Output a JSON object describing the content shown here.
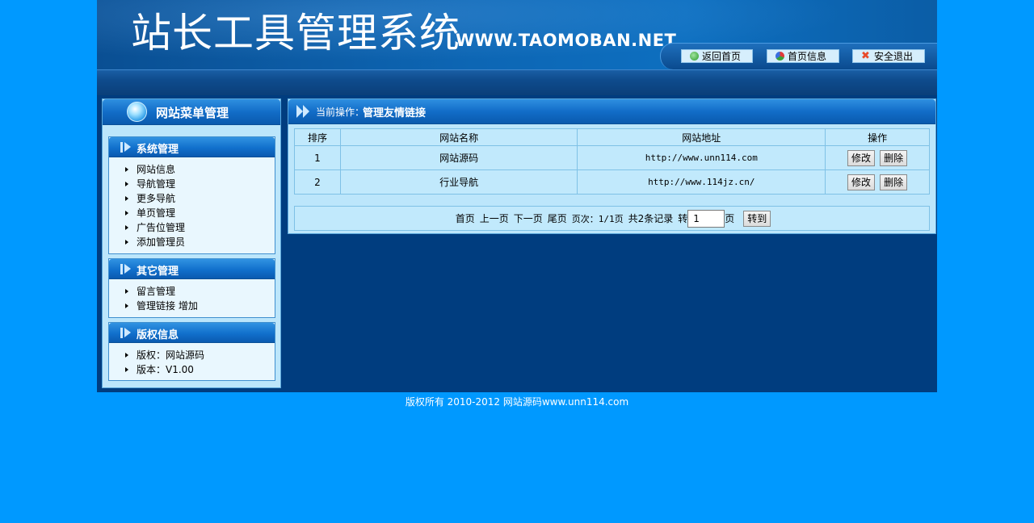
{
  "header": {
    "title": "站长工具管理系统",
    "url": "WWW.TAOMOBAN.NET",
    "buttons": [
      {
        "label": "返回首页",
        "icon": "refresh-icon"
      },
      {
        "label": "首页信息",
        "icon": "pie-chart-icon"
      },
      {
        "label": "安全退出",
        "icon": "close-icon"
      }
    ]
  },
  "sidebar": {
    "title": "网站菜单管理",
    "sections": [
      {
        "title": "系统管理",
        "items": [
          "网站信息",
          "导航管理",
          "更多导航",
          "单页管理",
          "广告位管理",
          "添加管理员"
        ]
      },
      {
        "title": "其它管理",
        "items": [
          "留言管理",
          "管理链接 增加"
        ]
      },
      {
        "title": "版权信息",
        "items": [
          "版权：网站源码",
          "版本：V1.00"
        ]
      }
    ]
  },
  "main": {
    "crumb_prefix": "当前操作：",
    "crumb_current": "管理友情链接",
    "table": {
      "headers": [
        "排序",
        "网站名称",
        "网站地址",
        "操作"
      ],
      "rows": [
        {
          "order": "1",
          "name": "网站源码",
          "url": "http://www.unn114.com"
        },
        {
          "order": "2",
          "name": "行业导航",
          "url": "http://www.114jz.cn/"
        }
      ],
      "edit_label": "修改",
      "delete_label": "删除"
    },
    "pager": {
      "first": "首页",
      "prev": "上一页",
      "next": "下一页",
      "last": "尾页",
      "page_info": "页次：1/1页",
      "total": "共2条记录",
      "goto_prefix": "转",
      "page_value": "1",
      "page_suffix": "页",
      "go_label": "转到"
    }
  },
  "footer": {
    "text": "版权所有 2010-2012 网站源码www.unn114.com"
  },
  "colors": {
    "page_bg": "#0099ff",
    "frame_bg": "#003d7f",
    "panel_bg": "#bce6fb",
    "header_blue": "#0d66b4"
  }
}
